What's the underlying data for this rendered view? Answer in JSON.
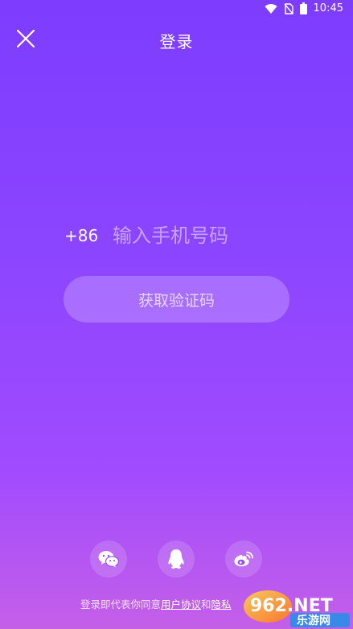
{
  "status_bar": {
    "time": "10:45",
    "icons": [
      "wifi-icon",
      "no-sim-icon",
      "battery-icon"
    ]
  },
  "header": {
    "title": "登录",
    "close_icon": "close-icon"
  },
  "login_form": {
    "country_code": "+86",
    "phone_placeholder": "输入手机号码",
    "get_code_label": "获取验证码"
  },
  "social_login": [
    {
      "name": "wechat",
      "icon": "wechat-icon"
    },
    {
      "name": "qq",
      "icon": "qq-icon"
    },
    {
      "name": "weibo",
      "icon": "weibo-icon"
    }
  ],
  "agreement": {
    "prefix": "登录即代表你同意",
    "user_agreement": "用户协议",
    "conjunction": "和",
    "privacy": "隐私"
  },
  "watermark": {
    "text": "962.NET",
    "subtext": "乐游网"
  },
  "colors": {
    "bg_top": "#7d3cff",
    "bg_bottom": "#c45fe8"
  }
}
